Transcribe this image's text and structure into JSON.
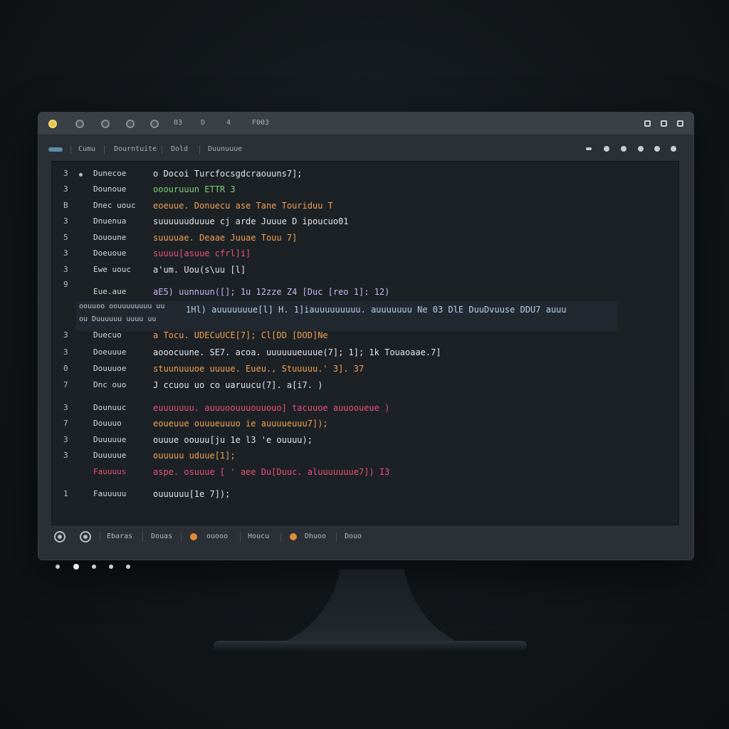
{
  "titlebar": {
    "labels": [
      "03",
      "D",
      "4",
      "F003"
    ]
  },
  "toolbar": {
    "items": [
      "Cumu",
      "Dourntuite",
      "Dold",
      "Duunuuue"
    ]
  },
  "code": {
    "lines": [
      {
        "num": "3",
        "kw": "Dunecoe",
        "expr": "o Docoi Turcfocsgdcraouuns7];"
      },
      {
        "num": "3",
        "kw": "Dounoue",
        "expr": "ooouruuun ETTR 3"
      },
      {
        "num": "B",
        "kw": "Dnec uouc",
        "expr": "eoeuue. Donuecu ase Tane Touriduu T"
      },
      {
        "num": "3",
        "kw": "Dnuenua",
        "expr": "suuuuuuduuue  cj  arde  Juuue  D ipoucuo01"
      },
      {
        "num": "5",
        "kw": "Dououne",
        "expr": "suuuuae. Deaae Juuae Touu 7]"
      },
      {
        "num": "3",
        "kw": "Doeuoue",
        "expr": "suuuu[asuue  cfrl]i]"
      },
      {
        "num": "3",
        "kw": "Ewe uouc",
        "expr": "a'um. Uou(s\\uu [l]"
      },
      {
        "num": "9",
        "kw": "",
        "expr": ""
      },
      {
        "num": "",
        "kw": "Eue.aue",
        "expr": "aE5) uunnuun([]; 1u 12zze  Z4 [Duc [reo 1]: 12)"
      },
      {
        "num": "3",
        "kw": "Duecuo",
        "expr": "a Tocu. UDECuUCE[7]; Cl[DD [DOD]Ne"
      },
      {
        "num": "3",
        "kw": "Doeuuue",
        "expr": "aooocuune. SE7. acoa. uuuuuueuuue(7]; 1]; 1k  Touaoaae.7]"
      },
      {
        "num": "0",
        "kw": "Douuuoe",
        "expr": "stuunuuuoe  uuuue. Eueu., Stuuuuu.' 3]. 37"
      },
      {
        "num": "7",
        "kw": "Dnc ouo",
        "expr": "J ccuou uo  co  uaruucu(7]. a[i7. )"
      },
      {
        "num": "3",
        "kw": "Dounuuc",
        "expr": "euuuuuuu. auuuoouuuouuouo]  tacuuoe  auuooueue  )"
      },
      {
        "num": "7",
        "kw": "Douuuo",
        "expr": "eoueuue  ouuueuuuo  ie  auuuueuuu7]);"
      },
      {
        "num": "3",
        "kw": "Duuuuue",
        "expr": "ouuue  oouuu[ju  1e  l3  'e  ouuuu);"
      },
      {
        "num": "3",
        "kw": "Duuuuue",
        "expr": "ouuuuu uduue[1];"
      },
      {
        "num": "",
        "kw": "Fauuuus",
        "expr": "aspe. osuuue [ ' aee  Du[Duuc. aluuuuuuue7]) I3"
      },
      {
        "num": "1",
        "kw": "Fauuuuu",
        "expr": "ouuuuuu[1e 7]);"
      }
    ],
    "highlight": {
      "left": "oouuoo  oouuuuuuuu  uu",
      "left2": "ou Duuuuuu  uuuu  uu",
      "main": "1Hl) auuuuuuue[l] H. 1]iauuuuuuuuu. auuuuuuu Ne  03  DlE  DuuDvuuse  DDU7 auuu"
    }
  },
  "statusbar": {
    "items": [
      "Ebaras",
      "Douas",
      "ouooo",
      "Houcu",
      "Dhuoo",
      "Douo"
    ]
  }
}
